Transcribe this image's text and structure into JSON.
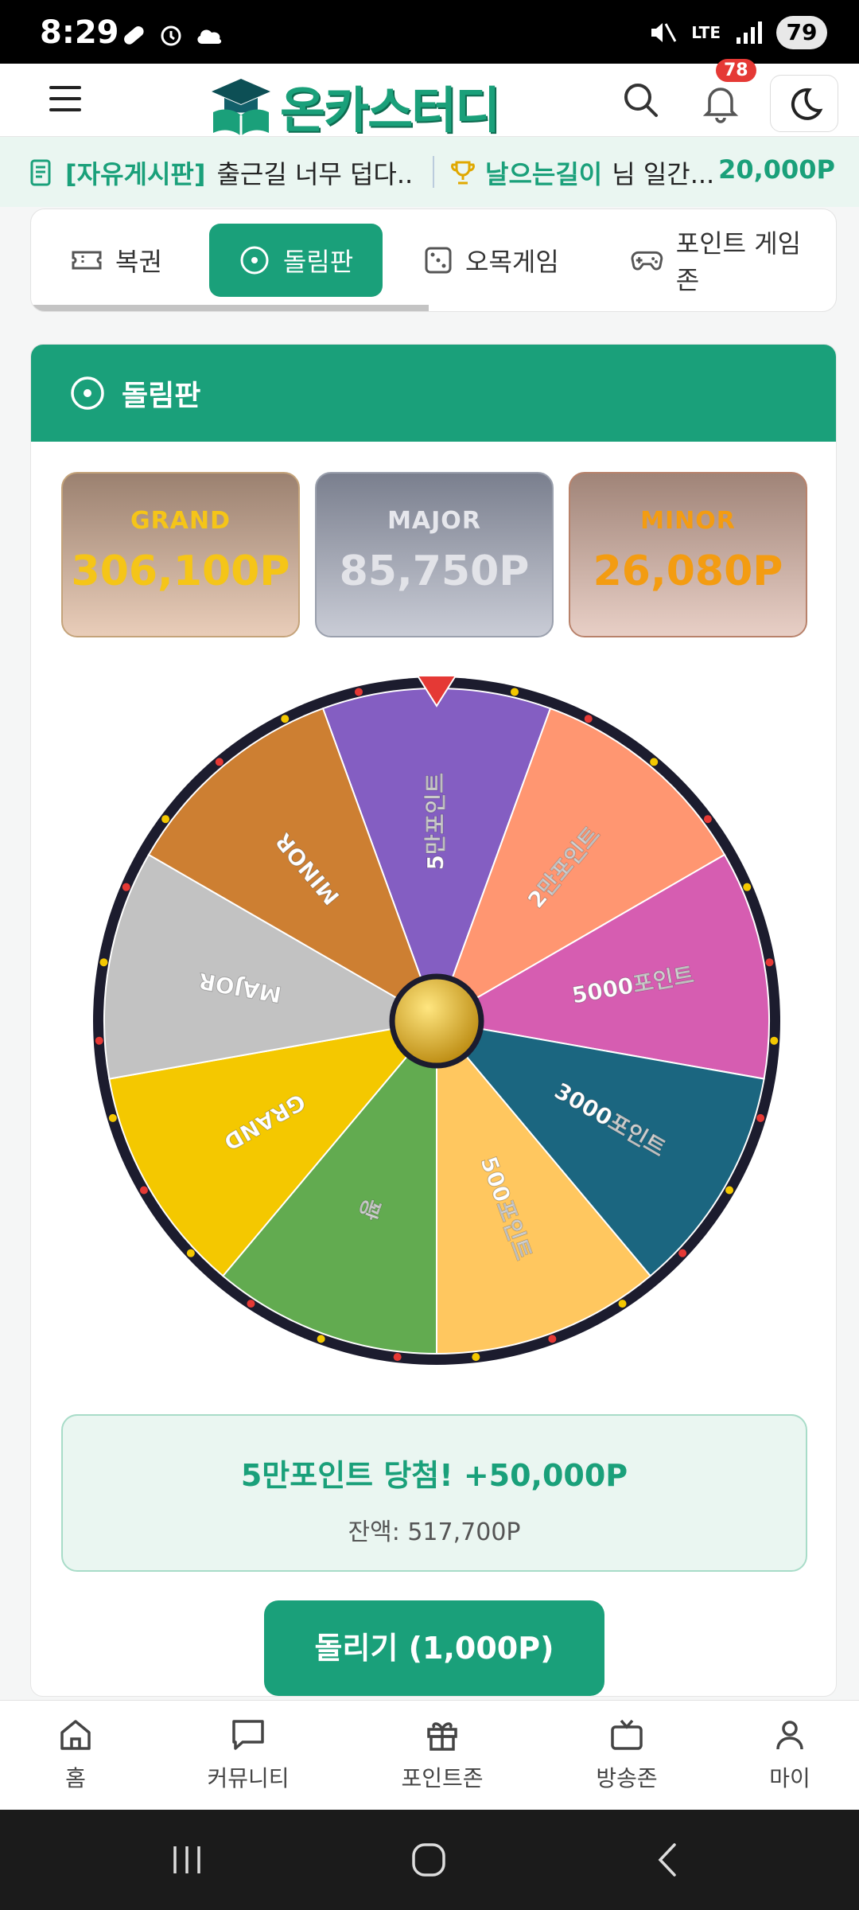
{
  "status_bar": {
    "time": "8:29",
    "network": "LTE",
    "battery": "79"
  },
  "header": {
    "logo_text": "온카스터디",
    "notification_count": "78"
  },
  "ticker": {
    "board": "[자유게시판]",
    "post_title": "출근길 너무 덥다..",
    "winner_name": "날으는길이",
    "winner_suffix": "님 일간...",
    "winner_points": "20,000P"
  },
  "tabs": [
    {
      "label": "복권",
      "icon": "ticket-icon"
    },
    {
      "label": "돌림판",
      "icon": "roulette-icon",
      "active": true
    },
    {
      "label": "오목게임",
      "icon": "dice-icon"
    },
    {
      "label": "포인트 게임존",
      "icon": "gamepad-icon"
    }
  ],
  "roulette": {
    "title": "돌림판",
    "jackpots": {
      "grand": {
        "label": "GRAND",
        "value": "306,100P"
      },
      "major": {
        "label": "MAJOR",
        "value": "85,750P"
      },
      "minor": {
        "label": "MINOR",
        "value": "26,080P"
      }
    },
    "segments": [
      {
        "label": "5만포인트",
        "color": "#845ec2"
      },
      {
        "label": "2만포인트",
        "color": "#ff9671"
      },
      {
        "label": "5000포인트",
        "color": "#d65db1"
      },
      {
        "label": "3000포인트",
        "color": "#1b6680"
      },
      {
        "label": "500포인트",
        "color": "#ffc75f"
      },
      {
        "label": "꽝",
        "color": "#62ab50"
      },
      {
        "label": "GRAND",
        "color": "#f4c800"
      },
      {
        "label": "MAJOR",
        "color": "#c2c2c2"
      },
      {
        "label": "MINOR",
        "color": "#cd7f32"
      }
    ],
    "result_title": "5만포인트 당첨! +50,000P",
    "result_balance": "잔액: 517,700P",
    "spin_button": "돌리기 (1,000P)"
  },
  "bottom_nav": [
    {
      "label": "홈",
      "icon": "home-icon"
    },
    {
      "label": "커뮤니티",
      "icon": "chat-icon"
    },
    {
      "label": "포인트존",
      "icon": "gift-icon"
    },
    {
      "label": "방송존",
      "icon": "tv-icon"
    },
    {
      "label": "마이",
      "icon": "user-icon"
    }
  ],
  "colors": {
    "primary": "#1aa07a",
    "grand": "#f5c518",
    "minor": "#f39c12",
    "badge": "#e53935"
  }
}
